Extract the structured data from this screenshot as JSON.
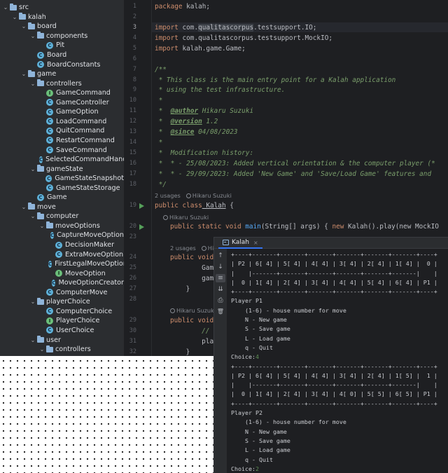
{
  "tree": [
    {
      "label": "src",
      "depth": 0,
      "kind": "folder",
      "open": true
    },
    {
      "label": "kalah",
      "depth": 1,
      "kind": "folder",
      "open": true
    },
    {
      "label": "board",
      "depth": 2,
      "kind": "folder",
      "open": true
    },
    {
      "label": "components",
      "depth": 3,
      "kind": "folder",
      "open": true
    },
    {
      "label": "Pit",
      "depth": 4,
      "kind": "class"
    },
    {
      "label": "Board",
      "depth": 3,
      "kind": "class"
    },
    {
      "label": "BoardConstants",
      "depth": 3,
      "kind": "class"
    },
    {
      "label": "game",
      "depth": 2,
      "kind": "folder",
      "open": true
    },
    {
      "label": "controllers",
      "depth": 3,
      "kind": "folder",
      "open": true
    },
    {
      "label": "GameCommand",
      "depth": 4,
      "kind": "interface"
    },
    {
      "label": "GameController",
      "depth": 4,
      "kind": "class"
    },
    {
      "label": "GameOption",
      "depth": 4,
      "kind": "class"
    },
    {
      "label": "LoadCommand",
      "depth": 4,
      "kind": "class"
    },
    {
      "label": "QuitCommand",
      "depth": 4,
      "kind": "class"
    },
    {
      "label": "RestartCommand",
      "depth": 4,
      "kind": "class"
    },
    {
      "label": "SaveCommand",
      "depth": 4,
      "kind": "class"
    },
    {
      "label": "SelectedCommandHandler",
      "depth": 4,
      "kind": "class"
    },
    {
      "label": "gameState",
      "depth": 3,
      "kind": "folder",
      "open": true
    },
    {
      "label": "GameStateSnapshot",
      "depth": 4,
      "kind": "class"
    },
    {
      "label": "GameStateStorage",
      "depth": 4,
      "kind": "class"
    },
    {
      "label": "Game",
      "depth": 3,
      "kind": "class"
    },
    {
      "label": "move",
      "depth": 2,
      "kind": "folder",
      "open": true
    },
    {
      "label": "computer",
      "depth": 3,
      "kind": "folder",
      "open": true
    },
    {
      "label": "moveOptions",
      "depth": 4,
      "kind": "folder",
      "open": true
    },
    {
      "label": "CaptureMoveOption",
      "depth": 5,
      "kind": "class"
    },
    {
      "label": "DecisionMaker",
      "depth": 5,
      "kind": "class"
    },
    {
      "label": "ExtraMoveOption",
      "depth": 5,
      "kind": "class"
    },
    {
      "label": "FirstLegalMoveOption",
      "depth": 5,
      "kind": "class"
    },
    {
      "label": "MoveOption",
      "depth": 5,
      "kind": "interface"
    },
    {
      "label": "MoveOptionCreator",
      "depth": 5,
      "kind": "class"
    },
    {
      "label": "ComputerMove",
      "depth": 4,
      "kind": "class"
    },
    {
      "label": "playerChoice",
      "depth": 3,
      "kind": "folder",
      "open": true
    },
    {
      "label": "ComputerChoice",
      "depth": 4,
      "kind": "class"
    },
    {
      "label": "PlayerChoice",
      "depth": 4,
      "kind": "interface"
    },
    {
      "label": "UserChoice",
      "depth": 4,
      "kind": "class"
    },
    {
      "label": "user",
      "depth": 3,
      "kind": "folder",
      "open": true
    },
    {
      "label": "controllers",
      "depth": 4,
      "kind": "folder",
      "open": true
    }
  ],
  "editor": {
    "line_numbers": [
      "1",
      "2",
      "3",
      "4",
      "5",
      "6",
      "7",
      "8",
      "9",
      "10",
      "11",
      "12",
      "13",
      "14",
      "15",
      "16",
      "17",
      "18",
      "19",
      "20",
      "23",
      "24",
      "25",
      "26",
      "27",
      "28",
      "29",
      "30",
      "31",
      "32"
    ],
    "current_line": "3",
    "l1_kw": "package",
    "l1_rest": " kalah;",
    "l3_kw": "import",
    "l3_pre": " com.",
    "l3_sel": "qualitascorpus",
    "l3_post": ".testsupport.IO;",
    "l4_kw": "import",
    "l4_rest": " com.qualitascorpus.testsupport.MockIO;",
    "l5_kw": "import",
    "l5_rest": " kalah.game.Game;",
    "l7": "/**",
    "l8": " * This class is the main entry point for a Kalah application",
    "l9": " * using the test infrastructure.",
    "l10": " *",
    "l11_pre": " *  ",
    "l11_tag": "@author",
    "l11_post": " Hikaru Suzuki",
    "l12_pre": " *  ",
    "l12_tag": "@version",
    "l12_post": " 1.2",
    "l13_pre": " *  ",
    "l13_tag": "@since",
    "l13_post": " 04/08/2023",
    "l14": " *",
    "l15": " *  Modification history:",
    "l16": " *  * - 25/08/2023: Added vertical orientation & the computer player (*",
    "l17": " *  * - 29/09/2023: Added 'New Game' and 'Save/Load Game' features and",
    "l18": " */",
    "hint1_usages": "2 usages",
    "hint1_author": "Hikaru Suzuki",
    "l19_kw": "public class",
    "l19_name": " Kalah",
    "l19_rest": " {",
    "hint2_author": "Hikaru Suzuki",
    "l20_kw": "public static void",
    "l20_name": " main",
    "l20_rest": "(String[] args) { ",
    "l20_kw2": "new",
    "l20_rest2": " Kalah().play(new MockIO",
    "hint3_usages": "2 usages",
    "hint3_author": "Hik",
    "l24_kw": "public void",
    "l25": "        Game gam",
    "l26": "        game.sta",
    "l27": "    }",
    "hint4_author": "Hikaru Suzuki",
    "l29_kw": "public void",
    "l30": "        // DO NO",
    "l31": "        play(io)",
    "l32": "    }"
  },
  "console": {
    "tab_label": "Kalah",
    "close_glyph": "×",
    "lines": [
      "+----+-------+-------+-------+-------+-------+-------+----+",
      "| P2 | 6[ 4] | 5[ 4] | 4[ 4] | 3[ 4] | 2[ 4] | 1[ 4] |  0 |",
      "|    |-------+-------+-------+-------+-------+-------|    |",
      "|  0 | 1[ 4] | 2[ 4] | 3[ 4] | 4[ 4] | 5[ 4] | 6[ 4] | P1 |",
      "+----+-------+-------+-------+-------+-------+-------+----+",
      "Player P1",
      "    (1-6) - house number for move",
      "    N - New game",
      "    S - Save game",
      "    L - Load game",
      "    q - Quit",
      {
        "text": "Choice:",
        "input": "4"
      },
      "+----+-------+-------+-------+-------+-------+-------+----+",
      "| P2 | 6[ 4] | 5[ 4] | 4[ 4] | 3[ 4] | 2[ 4] | 1[ 5] |  1 |",
      "|    |-------+-------+-------+-------+-------+-------|    |",
      "|  0 | 1[ 4] | 2[ 4] | 3[ 4] | 4[ 0] | 5[ 5] | 6[ 5] | P1 |",
      "+----+-------+-------+-------+-------+-------+-------+----+",
      "Player P2",
      "    (1-6) - house number for move",
      "    N - New game",
      "    S - Save game",
      "    L - Load game",
      "    q - Quit",
      {
        "text": "Choice:",
        "input": "2"
      }
    ],
    "tools": [
      "↑",
      "↓",
      "≡",
      "⇊",
      "⎙",
      "🗑"
    ]
  }
}
